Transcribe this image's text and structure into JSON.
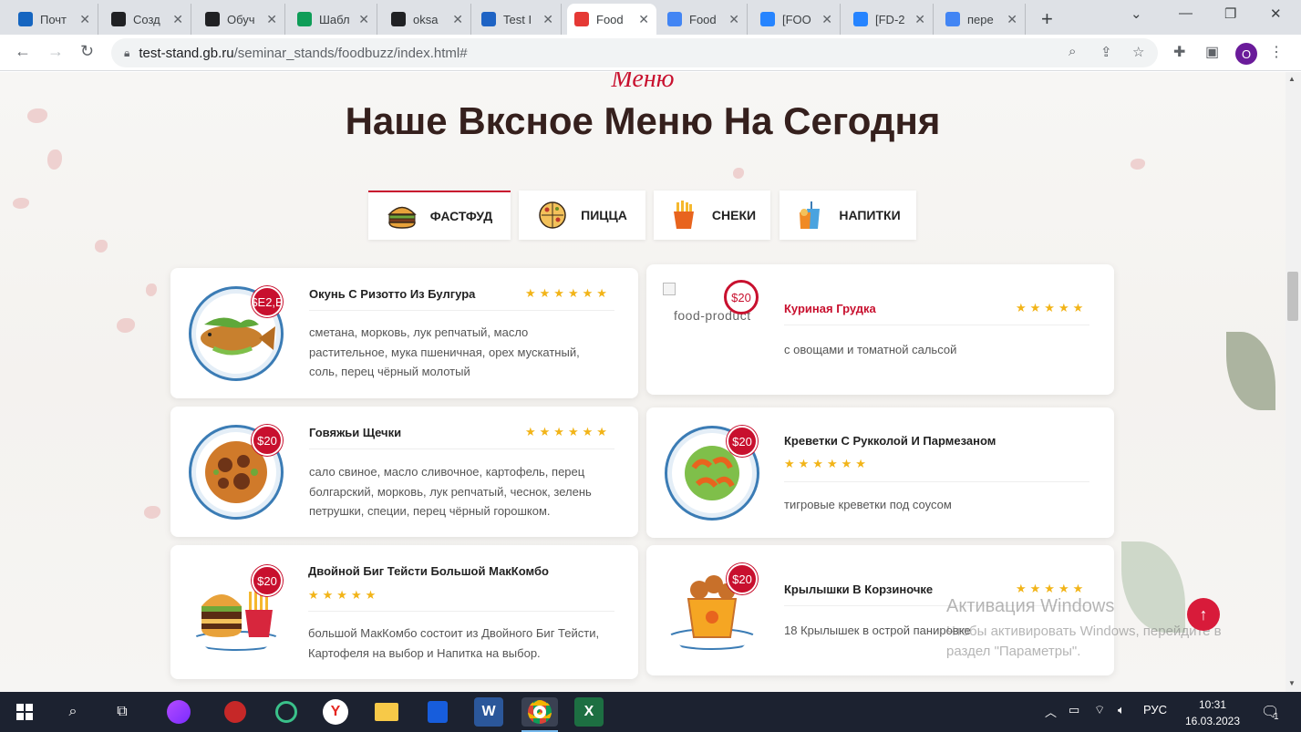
{
  "browser": {
    "tabs": [
      {
        "title": "Почт",
        "favicon": "mail-icon",
        "color": "#1565c0"
      },
      {
        "title": "Созд",
        "favicon": "openai-icon",
        "color": "#202124"
      },
      {
        "title": "Обуч",
        "favicon": "openai-icon",
        "color": "#202124"
      },
      {
        "title": "Шабл",
        "favicon": "sheets-icon",
        "color": "#0f9d58"
      },
      {
        "title": "oksa",
        "favicon": "github-icon",
        "color": "#202124"
      },
      {
        "title": "Test I",
        "favicon": "test-icon",
        "color": "#1e63c4"
      },
      {
        "title": "Food",
        "favicon": "foodbuzz-icon",
        "color": "#e53935"
      },
      {
        "title": "Food",
        "favicon": "docs-icon",
        "color": "#4285f4"
      },
      {
        "title": "[FOO",
        "favicon": "jira-icon",
        "color": "#2684ff"
      },
      {
        "title": "[FD-2",
        "favicon": "jira-icon",
        "color": "#2684ff"
      },
      {
        "title": "пере",
        "favicon": "google-icon",
        "color": "#4285f4"
      }
    ],
    "url_host": "test-stand.gb.ru",
    "url_path": "/seminar_stands/foodbuzz/index.html#",
    "profile_initial": "O"
  },
  "page": {
    "kicker": "Меню",
    "title": "Наше Вксное Меню На Сегодня",
    "categories": [
      {
        "label": "ФАСТФУД",
        "icon": "burger-icon"
      },
      {
        "label": "ПИЦЦА",
        "icon": "pizza-icon"
      },
      {
        "label": "СНЕКИ",
        "icon": "fries-icon"
      },
      {
        "label": "НАПИТКИ",
        "icon": "drinks-icon"
      }
    ],
    "dishes": [
      {
        "name": "Окунь С Ризотто Из Булгура",
        "price": "$E2,B",
        "rating": 6,
        "desc": "сметана, морковь, лук репчатый, масло растительное, мука пшеничная, орех мускатный, соль, перец чёрный молотый"
      },
      {
        "name": "Куриная Грудка",
        "price": "$20",
        "rating": 5,
        "broken_image_alt": "food-product",
        "desc": "с овощами и томатной сальсой"
      },
      {
        "name": "Говяжьи Щечки",
        "price": "$20",
        "rating": 6,
        "desc": "сало свиное, масло сливочное, картофель, перец болгарский, морковь, лук репчатый, чеснок, зелень петрушки, специи, перец чёрный горошком."
      },
      {
        "name": "Креветки С Рукколой И Пармезаном",
        "price": "$20",
        "rating": 6,
        "desc": "тигровые креветки под соусом"
      },
      {
        "name": "Двойной Биг Тейсти Большой МакКомбо",
        "price": "$20",
        "rating": 5,
        "desc": "большой МакКомбо состоит из Двойного Биг Тейсти, Картофеля на выбор и Напитка на выбор."
      },
      {
        "name": "Крылышки В Корзиночке",
        "price": "$20",
        "rating": 5,
        "desc": "18 Крылышек в острой панировке"
      }
    ],
    "star_char": "★",
    "back_to_top": "↑"
  },
  "os": {
    "activation_title": "Активация Windows",
    "activation_text_1": "Чтобы активировать Windows, перейдите в",
    "activation_text_2": "раздел \"Параметры\".",
    "lang": "РУС",
    "time": "10:31",
    "date": "16.03.2023",
    "notifications": "1"
  },
  "colors": {
    "accent": "#c8102e",
    "star": "#f2b418",
    "title": "#35201d"
  }
}
